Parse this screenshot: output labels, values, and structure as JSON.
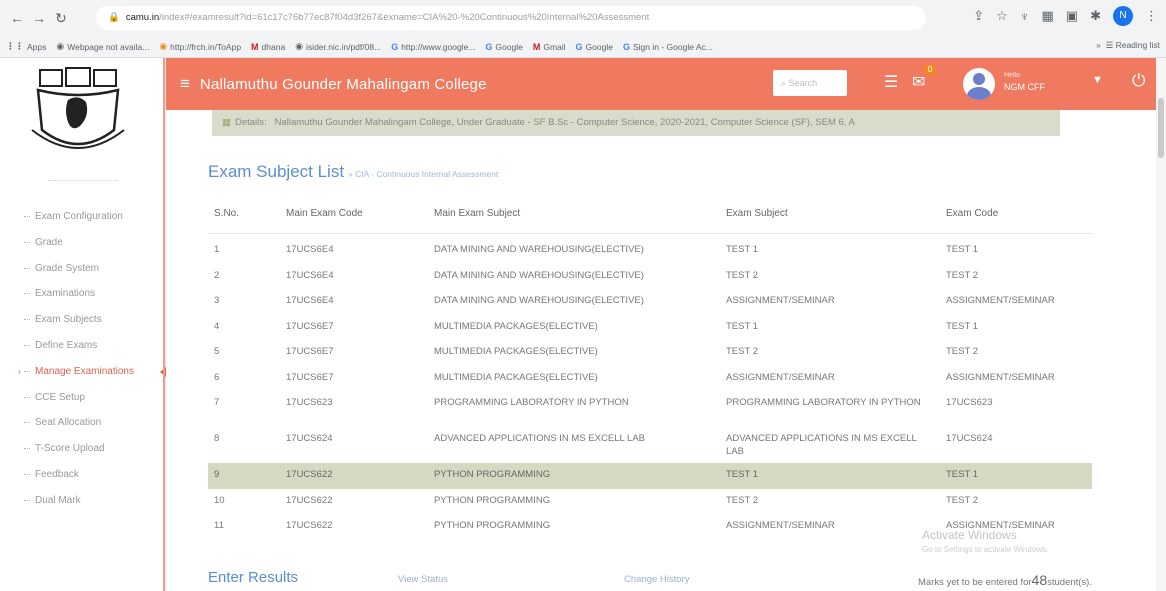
{
  "browser": {
    "url_host": "camu.in",
    "url_rest": "/index#/examresult?id=61c17c76b77ec87f04d3f267&exname=CIA%20-%20Continuous%20Internal%20Assessment",
    "profile_initial": "N",
    "bookmarks": [
      "Apps",
      "Webpage not availa...",
      "http://frch.in/ToApp",
      "dhana",
      "isider.nic.in/pdf/08...",
      "http://www.google...",
      "Google",
      "Gmail",
      "Google",
      "Sign in - Google Ac..."
    ],
    "reading_list": "Reading list"
  },
  "header": {
    "college": "Nallamuthu Gounder Mahalingam College",
    "search_placeholder": "Search",
    "notification_count": "0",
    "hello": "Hello",
    "user_name": "NGM CFF"
  },
  "details": {
    "label": "Details:",
    "text": "Nallamuthu Gounder Mahalingam College, Under Graduate - SF B.Sc - Computer Science, 2020-2021, Computer Science (SF), SEM 6, A"
  },
  "sidebar": {
    "items": [
      {
        "label": "Exam Configuration"
      },
      {
        "label": "Grade"
      },
      {
        "label": "Grade System"
      },
      {
        "label": "Examinations"
      },
      {
        "label": "Exam Subjects"
      },
      {
        "label": "Define Exams"
      },
      {
        "label": "Manage Examinations"
      },
      {
        "label": "CCE Setup"
      },
      {
        "label": "Seat Allocation"
      },
      {
        "label": "T-Score Upload"
      },
      {
        "label": "Feedback"
      },
      {
        "label": "Dual Mark"
      }
    ]
  },
  "page": {
    "title": "Exam Subject List",
    "crumb": "» CIA - Continuous Internal Assessment"
  },
  "table": {
    "headers": [
      "S.No.",
      "Main Exam Code",
      "Main Exam Subject",
      "Exam Subject",
      "Exam Code"
    ],
    "rows": [
      {
        "sno": "1",
        "code": "17UCS6E4",
        "subject": "DATA MINING AND WAREHOUSING(ELECTIVE)",
        "exam_subject": "TEST 1",
        "exam_code": "TEST 1"
      },
      {
        "sno": "2",
        "code": "17UCS6E4",
        "subject": "DATA MINING AND WAREHOUSING(ELECTIVE)",
        "exam_subject": "TEST 2",
        "exam_code": "TEST 2"
      },
      {
        "sno": "3",
        "code": "17UCS6E4",
        "subject": "DATA MINING AND WAREHOUSING(ELECTIVE)",
        "exam_subject": "ASSIGNMENT/SEMINAR",
        "exam_code": "ASSIGNMENT/SEMINAR"
      },
      {
        "sno": "4",
        "code": "17UCS6E7",
        "subject": "MULTIMEDIA PACKAGES(ELECTIVE)",
        "exam_subject": "TEST 1",
        "exam_code": "TEST 1"
      },
      {
        "sno": "5",
        "code": "17UCS6E7",
        "subject": "MULTIMEDIA PACKAGES(ELECTIVE)",
        "exam_subject": "TEST 2",
        "exam_code": "TEST 2"
      },
      {
        "sno": "6",
        "code": "17UCS6E7",
        "subject": "MULTIMEDIA PACKAGES(ELECTIVE)",
        "exam_subject": "ASSIGNMENT/SEMINAR",
        "exam_code": "ASSIGNMENT/SEMINAR"
      },
      {
        "sno": "7",
        "code": "17UCS623",
        "subject": "PROGRAMMING LABORATORY IN PYTHON",
        "exam_subject": "PROGRAMMING LABORATORY IN PYTHON",
        "exam_code": "17UCS623"
      },
      {
        "sno": "8",
        "code": "17UCS624",
        "subject": "ADVANCED APPLICATIONS IN MS EXCELL LAB",
        "exam_subject": "ADVANCED APPLICATIONS IN MS EXCELL LAB",
        "exam_code": "17UCS624"
      },
      {
        "sno": "9",
        "code": "17UCS622",
        "subject": "PYTHON PROGRAMMING",
        "exam_subject": "TEST 1",
        "exam_code": "TEST 1"
      },
      {
        "sno": "10",
        "code": "17UCS622",
        "subject": "PYTHON PROGRAMMING",
        "exam_subject": "TEST 2",
        "exam_code": "TEST 2"
      },
      {
        "sno": "11",
        "code": "17UCS622",
        "subject": "PYTHON PROGRAMMING",
        "exam_subject": "ASSIGNMENT/SEMINAR",
        "exam_code": "ASSIGNMENT/SEMINAR"
      }
    ]
  },
  "footer": {
    "enter_results": "Enter Results",
    "view_status": "View Status",
    "change_history": "Change History",
    "marks_prefix": "Marks yet to be entered for",
    "marks_count": "48",
    "marks_suffix": "student(s)."
  },
  "watermark": {
    "line1": "Activate Windows",
    "line2": "Go to Settings to activate Windows."
  },
  "colors": {
    "topbar": "#f07a5f",
    "accent_blue": "#5b8fd0",
    "selected_row": "#d6d9c2",
    "details_bg": "#d9dcca"
  }
}
